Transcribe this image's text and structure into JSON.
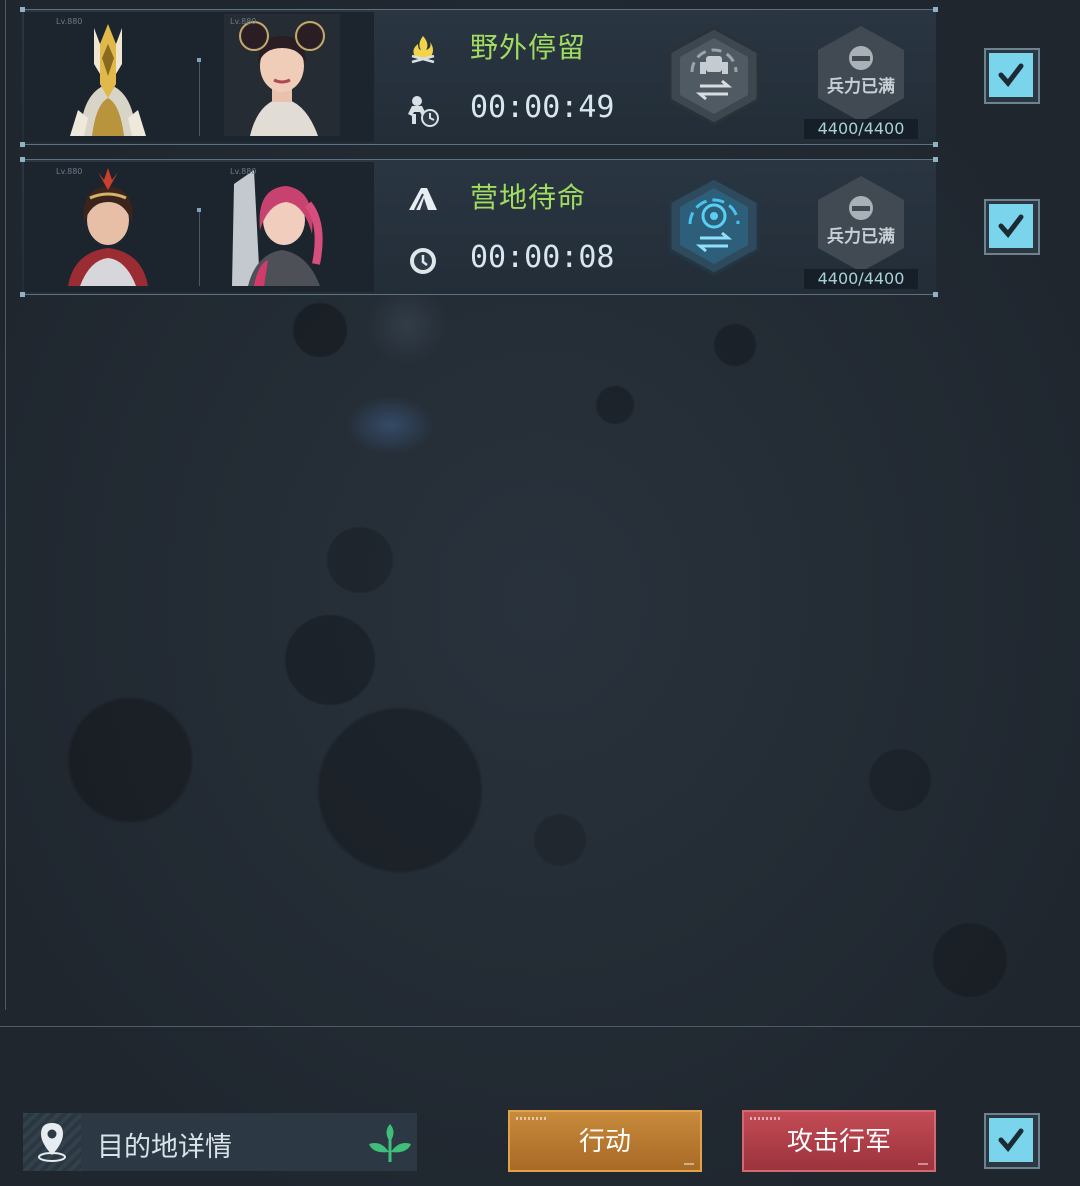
{
  "marches": [
    {
      "status_icon": "campfire-icon",
      "status_text": "野外停留",
      "timer_icon": "troop-clock-icon",
      "timer": "00:00:49",
      "swap_icon": "mech-swap-icon",
      "troop_label": "兵力已满",
      "troop_count": "4400/4400",
      "level_left": "Lv.880",
      "level_right": "Lv.880",
      "checked": true
    },
    {
      "status_icon": "tent-icon",
      "status_text": "营地待命",
      "timer_icon": "clock-icon",
      "timer": "00:00:08",
      "swap_icon": "hero-swap-icon",
      "troop_label": "兵力已满",
      "troop_count": "4400/4400",
      "level_left": "Lv.880",
      "level_right": "Lv.880",
      "checked": true
    }
  ],
  "bottom": {
    "destination_label": "目的地详情",
    "action_label": "行动",
    "attack_label": "攻击行军",
    "select_all_checked": true
  },
  "colors": {
    "status_green": "#9fdc5f",
    "checkbox_cyan": "#79d4ec",
    "action_orange": "#b8782f",
    "attack_red": "#b0404a"
  }
}
